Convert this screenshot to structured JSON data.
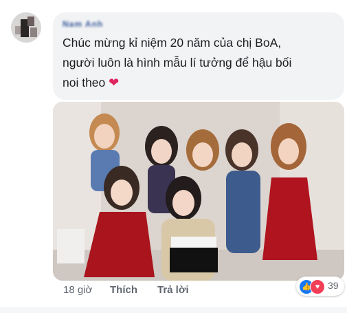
{
  "comment": {
    "author_name": "Nam Anh",
    "lines": [
      "Chúc mừng kỉ niệm 20 năm của chị BoA,",
      "người luôn là hình mẫu lí tưởng để hậu bối",
      "noi theo"
    ],
    "emoji_icon": "red-heart-icon",
    "time": "18 giờ",
    "like_label": "Thích",
    "reply_label": "Trả lời",
    "reaction_count": "39",
    "reaction_icons": [
      "like-icon",
      "love-icon"
    ]
  },
  "colors": {
    "bubble": "#f2f3f5",
    "author": "#385898",
    "meta": "#606770",
    "like": "#1877f2",
    "love": "#f33e58"
  }
}
